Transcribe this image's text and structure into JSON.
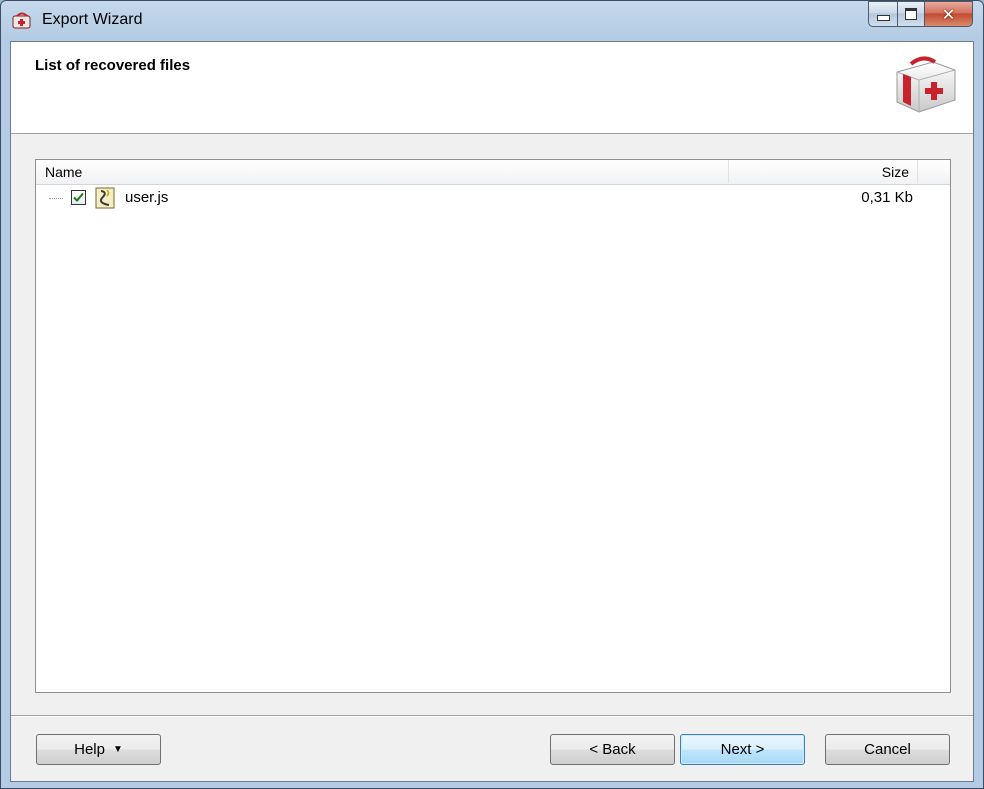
{
  "window": {
    "title": "Export Wizard",
    "icon": "app-aid-kit-icon",
    "controls": {
      "minimize": "minimize-icon",
      "maximize": "maximize-icon",
      "close": "close-icon"
    }
  },
  "header": {
    "title": "List of recovered files",
    "icon": "first-aid-kit-icon"
  },
  "file_list": {
    "columns": {
      "name": "Name",
      "size": "Size"
    },
    "rows": [
      {
        "name": "user.js",
        "size": "0,31 Kb",
        "checked": true,
        "icon": "script-file-icon"
      }
    ]
  },
  "buttons": {
    "help": "Help",
    "back": "< Back",
    "next": "Next >",
    "cancel": "Cancel"
  },
  "colors": {
    "accent_red": "#c8232c",
    "primary_button_border": "#3c7fb1",
    "title_bar": "#b3cbe4"
  }
}
